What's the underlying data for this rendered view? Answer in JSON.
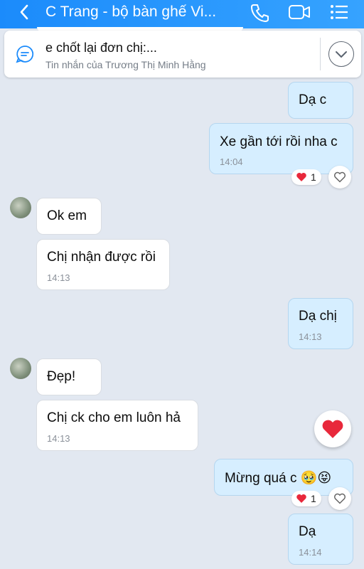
{
  "header": {
    "title": "C Trang - bộ bàn ghế Vi...",
    "accent": "#1b8bfb",
    "icons": [
      "back-icon",
      "phone-icon",
      "video-call-icon",
      "menu-icon"
    ]
  },
  "pinned": {
    "title": "e chốt lại đơn chị:...",
    "subtitle": "Tin nhắn của Trương Thị Minh Hằng"
  },
  "messages": [
    {
      "side": "out",
      "text": "Dạ c",
      "time": ""
    },
    {
      "side": "out",
      "text": "Xe gần tới rồi nha c",
      "time": "14:04",
      "reaction": {
        "emoji": "heart",
        "count": "1"
      }
    },
    {
      "side": "in",
      "text": "Ok em",
      "time": ""
    },
    {
      "side": "in",
      "text": "Chị nhận được rồi",
      "time": "14:13"
    },
    {
      "side": "out",
      "text": "Dạ chị",
      "time": "14:13"
    },
    {
      "side": "in",
      "text": "Đẹp!",
      "time": ""
    },
    {
      "side": "in",
      "text": "Chị ck cho em luôn hả",
      "time": "14:13"
    },
    {
      "side": "out",
      "text": "Mừng quá c 🥹😝",
      "time": "",
      "reaction": {
        "emoji": "heart",
        "count": "1"
      }
    },
    {
      "side": "out",
      "text": "Dạ",
      "time": "14:14"
    }
  ],
  "colors": {
    "outgoing_bubble": "#d6eeff",
    "incoming_bubble": "#ffffff",
    "heart": "#e8283b"
  }
}
